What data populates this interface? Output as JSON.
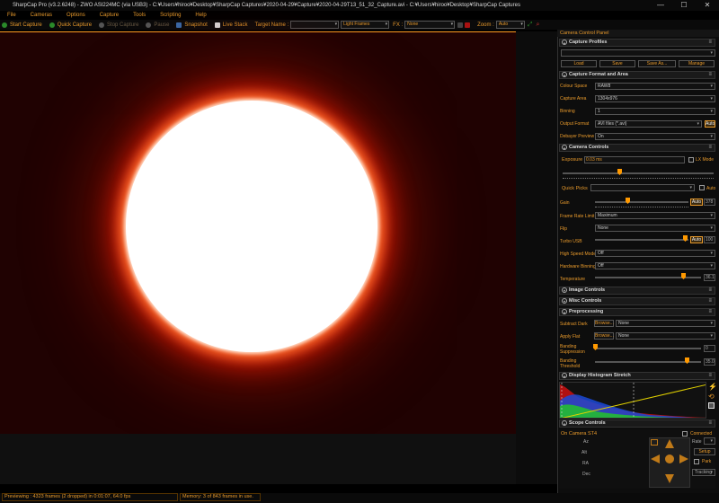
{
  "window": {
    "title": "SharpCap Pro (v3.2.6248) - ZWO ASI224MC (via USB3) - C:¥Users¥hiroo¥Desktop¥SharpCap Captures¥2020-04-29¥Capture¥2020-04-29T13_51_32_Capture.avi - C:¥Users¥hiroo¥Desktop¥SharpCap Captures",
    "minimize": "—",
    "maximize": "☐",
    "close": "✕"
  },
  "menu": [
    "File",
    "Cameras",
    "Options",
    "Capture",
    "Tools",
    "Scripting",
    "Help"
  ],
  "toolbar": {
    "start_capture": "Start Capture",
    "quick_capture": "Quick Capture",
    "stop_capture": "Stop Capture",
    "pause": "Pause",
    "snapshot": "Snapshot",
    "live_stack": "Live Stack",
    "target_name_label": "Target Name :",
    "target_name_value": "",
    "frame_type": "Light Frames",
    "fx_label": "FX :",
    "fx_value": "None",
    "zoom_label": "Zoom :",
    "zoom_value": "Auto"
  },
  "colors": {
    "accent": "#e89a2c",
    "sun_core": "#ffffff",
    "sun_limb": "#ff3a10",
    "background_sky": "#200202"
  },
  "panel": {
    "title": "Camera Control Panel",
    "capture_profiles": {
      "header": "Capture Profiles",
      "profile": "",
      "buttons": [
        "Load",
        "Save",
        "Save As...",
        "Manage"
      ]
    },
    "capture_format": {
      "header": "Capture Format and Area",
      "rows": [
        {
          "label": "Colour Space",
          "value": "RAW8"
        },
        {
          "label": "Capture Area",
          "value": "1304x976"
        },
        {
          "label": "Binning",
          "value": "1"
        },
        {
          "label": "Output Format",
          "value": "AVI files (*.avi)"
        },
        {
          "label": "Debayer Preview",
          "value": "On"
        }
      ],
      "auto": "Auto"
    },
    "camera_controls": {
      "header": "Camera Controls",
      "exposure_label": "Exposure",
      "exposure_value": "0.03 ms",
      "lx_mode": "LX Mode",
      "quick_picks": "Quick Picks",
      "auto": "Auto",
      "gain_label": "Gain",
      "gain_value": "378",
      "gain_auto": "Auto",
      "frame_rate_label": "Frame Rate Limit",
      "frame_rate_value": "Maximum",
      "flip_label": "Flip",
      "flip_value": "None",
      "turbo_label": "Turbo USB",
      "turbo_value": "100",
      "turbo_auto": "Auto",
      "hsm_label": "High Speed Mode",
      "hsm_value": "Off",
      "hwbin_label": "Hardware Binning",
      "hwbin_value": "Off",
      "temp_label": "Temperature",
      "temp_value": "36.1"
    },
    "image_controls": "Image Controls",
    "misc_controls": "Misc Controls",
    "preprocessing": {
      "header": "Preprocessing",
      "dark_label": "Subtract Dark",
      "dark_browse": "Browse...",
      "dark_value": "None",
      "flat_label": "Apply Flat",
      "flat_browse": "Browse...",
      "flat_value": "None",
      "banding_sup_label": "Banding Suppression",
      "banding_sup_value": "0",
      "banding_thr_label": "Banding Threshold",
      "banding_thr_value": "35.0"
    },
    "histogram": {
      "header": "Display Histogram Stretch"
    },
    "scope": {
      "header": "Scope Controls",
      "device": "On Camera ST4",
      "connected": "Connected",
      "axes": [
        "Az",
        "Alt",
        "RA",
        "Dec"
      ],
      "rate_label": "Rate",
      "setup": "Setup",
      "park": "Park",
      "tracking": "Tracking"
    }
  },
  "status": {
    "preview": "Previewing : 4323 frames (2 dropped) in 0:01:07, 64.0 fps",
    "memory": "Memory: 3 of 843 frames in use."
  }
}
